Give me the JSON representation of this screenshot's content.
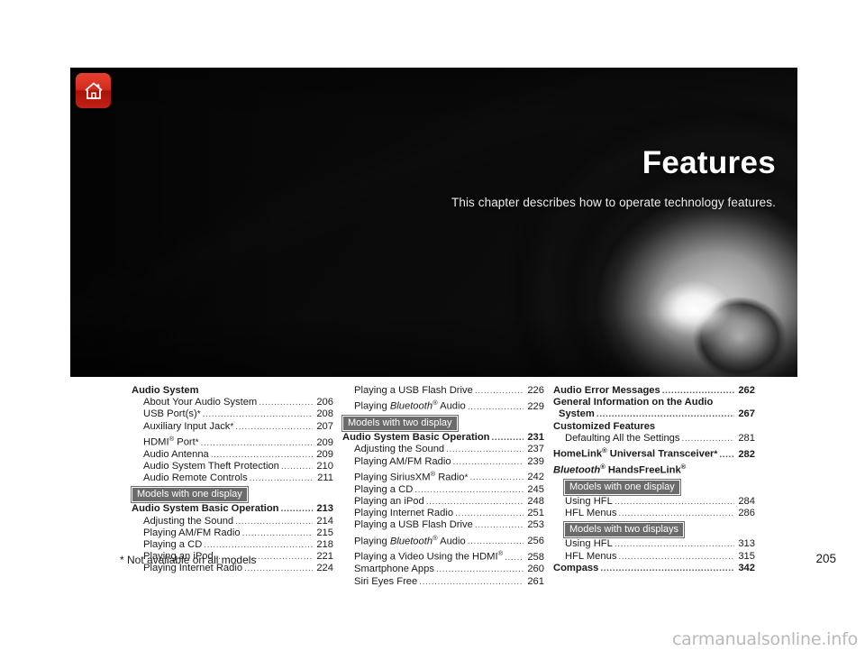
{
  "page": {
    "number": "205",
    "footnote": "* Not available on all models",
    "watermark": "carmanualsonline.info"
  },
  "hero": {
    "title": "Features",
    "subtitle": "This chapter describes how to operate technology features.",
    "home_icon": "home-icon",
    "accent_color": "#c2211a"
  },
  "toc": {
    "columns": [
      {
        "id": "column-1",
        "blocks": [
          {
            "type": "entry",
            "style": "head",
            "label": "Audio System",
            "page": "",
            "dots": false
          },
          {
            "type": "entry",
            "style": "sub",
            "label": "About Your Audio System",
            "page": "206",
            "dots": true
          },
          {
            "type": "entry",
            "style": "sub",
            "label": "USB Port(s)*",
            "page": "208",
            "dots": true
          },
          {
            "type": "entry",
            "style": "sub",
            "label": "Auxiliary Input Jack*",
            "page": "207",
            "dots": true
          },
          {
            "type": "entry",
            "style": "sub",
            "label": "HDMI® Port*",
            "page": "209",
            "dots": true
          },
          {
            "type": "entry",
            "style": "sub",
            "label": "Audio Antenna",
            "page": "209",
            "dots": true
          },
          {
            "type": "entry",
            "style": "sub",
            "label": "Audio System Theft Protection",
            "page": "210",
            "dots": true
          },
          {
            "type": "entry",
            "style": "sub",
            "label": "Audio Remote Controls",
            "page": "211",
            "dots": true
          },
          {
            "type": "badge",
            "label": "Models with one display"
          },
          {
            "type": "entry",
            "style": "head",
            "label": "Audio System Basic Operation",
            "page": "213",
            "dots": true
          },
          {
            "type": "entry",
            "style": "sub",
            "label": "Adjusting the Sound",
            "page": "214",
            "dots": true
          },
          {
            "type": "entry",
            "style": "sub",
            "label": "Playing AM/FM Radio",
            "page": "215",
            "dots": true
          },
          {
            "type": "entry",
            "style": "sub",
            "label": "Playing a CD",
            "page": "218",
            "dots": true
          },
          {
            "type": "entry",
            "style": "sub",
            "label": "Playing an iPod",
            "page": "221",
            "dots": true
          },
          {
            "type": "entry",
            "style": "sub",
            "label": "Playing Internet Radio",
            "page": "224",
            "dots": true
          }
        ]
      },
      {
        "id": "column-2",
        "blocks": [
          {
            "type": "entry",
            "style": "sub",
            "label": "Playing a USB Flash Drive",
            "page": "226",
            "dots": true
          },
          {
            "type": "entry",
            "style": "sub",
            "label": "Playing Bluetooth® Audio",
            "page": "229",
            "dots": true,
            "italic_prefix": "Bluetooth"
          },
          {
            "type": "badge",
            "label": "Models with two display"
          },
          {
            "type": "entry",
            "style": "head",
            "label": "Audio System Basic Operation",
            "page": "231",
            "dots": true
          },
          {
            "type": "entry",
            "style": "sub",
            "label": "Adjusting the Sound",
            "page": "237",
            "dots": true
          },
          {
            "type": "entry",
            "style": "sub",
            "label": "Playing AM/FM Radio",
            "page": "239",
            "dots": true
          },
          {
            "type": "entry",
            "style": "sub",
            "label": "Playing SiriusXM® Radio*",
            "page": "242",
            "dots": true
          },
          {
            "type": "entry",
            "style": "sub",
            "label": "Playing a CD",
            "page": "245",
            "dots": true
          },
          {
            "type": "entry",
            "style": "sub",
            "label": "Playing an iPod",
            "page": "248",
            "dots": true
          },
          {
            "type": "entry",
            "style": "sub",
            "label": "Playing Internet Radio",
            "page": "251",
            "dots": true
          },
          {
            "type": "entry",
            "style": "sub",
            "label": "Playing a USB Flash Drive",
            "page": "253",
            "dots": true
          },
          {
            "type": "entry",
            "style": "sub",
            "label": "Playing Bluetooth® Audio",
            "page": "256",
            "dots": true,
            "italic_prefix": "Bluetooth"
          },
          {
            "type": "entry",
            "style": "sub",
            "label": "Playing a Video Using the HDMI®",
            "page": "258",
            "dots": true
          },
          {
            "type": "entry",
            "style": "sub",
            "label": "Smartphone Apps",
            "page": "260",
            "dots": true
          },
          {
            "type": "entry",
            "style": "sub",
            "label": "Siri Eyes Free",
            "page": "261",
            "dots": true
          }
        ]
      },
      {
        "id": "column-3",
        "blocks": [
          {
            "type": "entry",
            "style": "head",
            "label": "Audio Error Messages",
            "page": "262",
            "dots": true
          },
          {
            "type": "entry",
            "style": "head",
            "label": "General Information on the Audio",
            "page": "",
            "dots": false
          },
          {
            "type": "entry",
            "style": "head cont",
            "label": "System",
            "page": "267",
            "dots": true
          },
          {
            "type": "entry",
            "style": "head",
            "label": "Customized Features",
            "page": "",
            "dots": false
          },
          {
            "type": "entry",
            "style": "sub",
            "label": "Defaulting All the Settings",
            "page": "281",
            "dots": true
          },
          {
            "type": "entry",
            "style": "head",
            "label": "HomeLink® Universal Transceiver*",
            "page": "282",
            "dots": true
          },
          {
            "type": "entry",
            "style": "head",
            "label": "Bluetooth® HandsFreeLink®",
            "page": "",
            "dots": false,
            "italic_prefix": "Bluetooth"
          },
          {
            "type": "badge",
            "label": "Models with one display",
            "indent": true
          },
          {
            "type": "entry",
            "style": "sub",
            "label": "Using HFL",
            "page": "284",
            "dots": true
          },
          {
            "type": "entry",
            "style": "sub",
            "label": "HFL Menus",
            "page": "286",
            "dots": true
          },
          {
            "type": "badge",
            "label": "Models with two displays",
            "indent": true
          },
          {
            "type": "entry",
            "style": "sub",
            "label": "Using HFL",
            "page": "313",
            "dots": true
          },
          {
            "type": "entry",
            "style": "sub",
            "label": "HFL Menus",
            "page": "315",
            "dots": true
          },
          {
            "type": "entry",
            "style": "head",
            "label": "Compass",
            "page": "342",
            "dots": true
          }
        ]
      }
    ]
  }
}
